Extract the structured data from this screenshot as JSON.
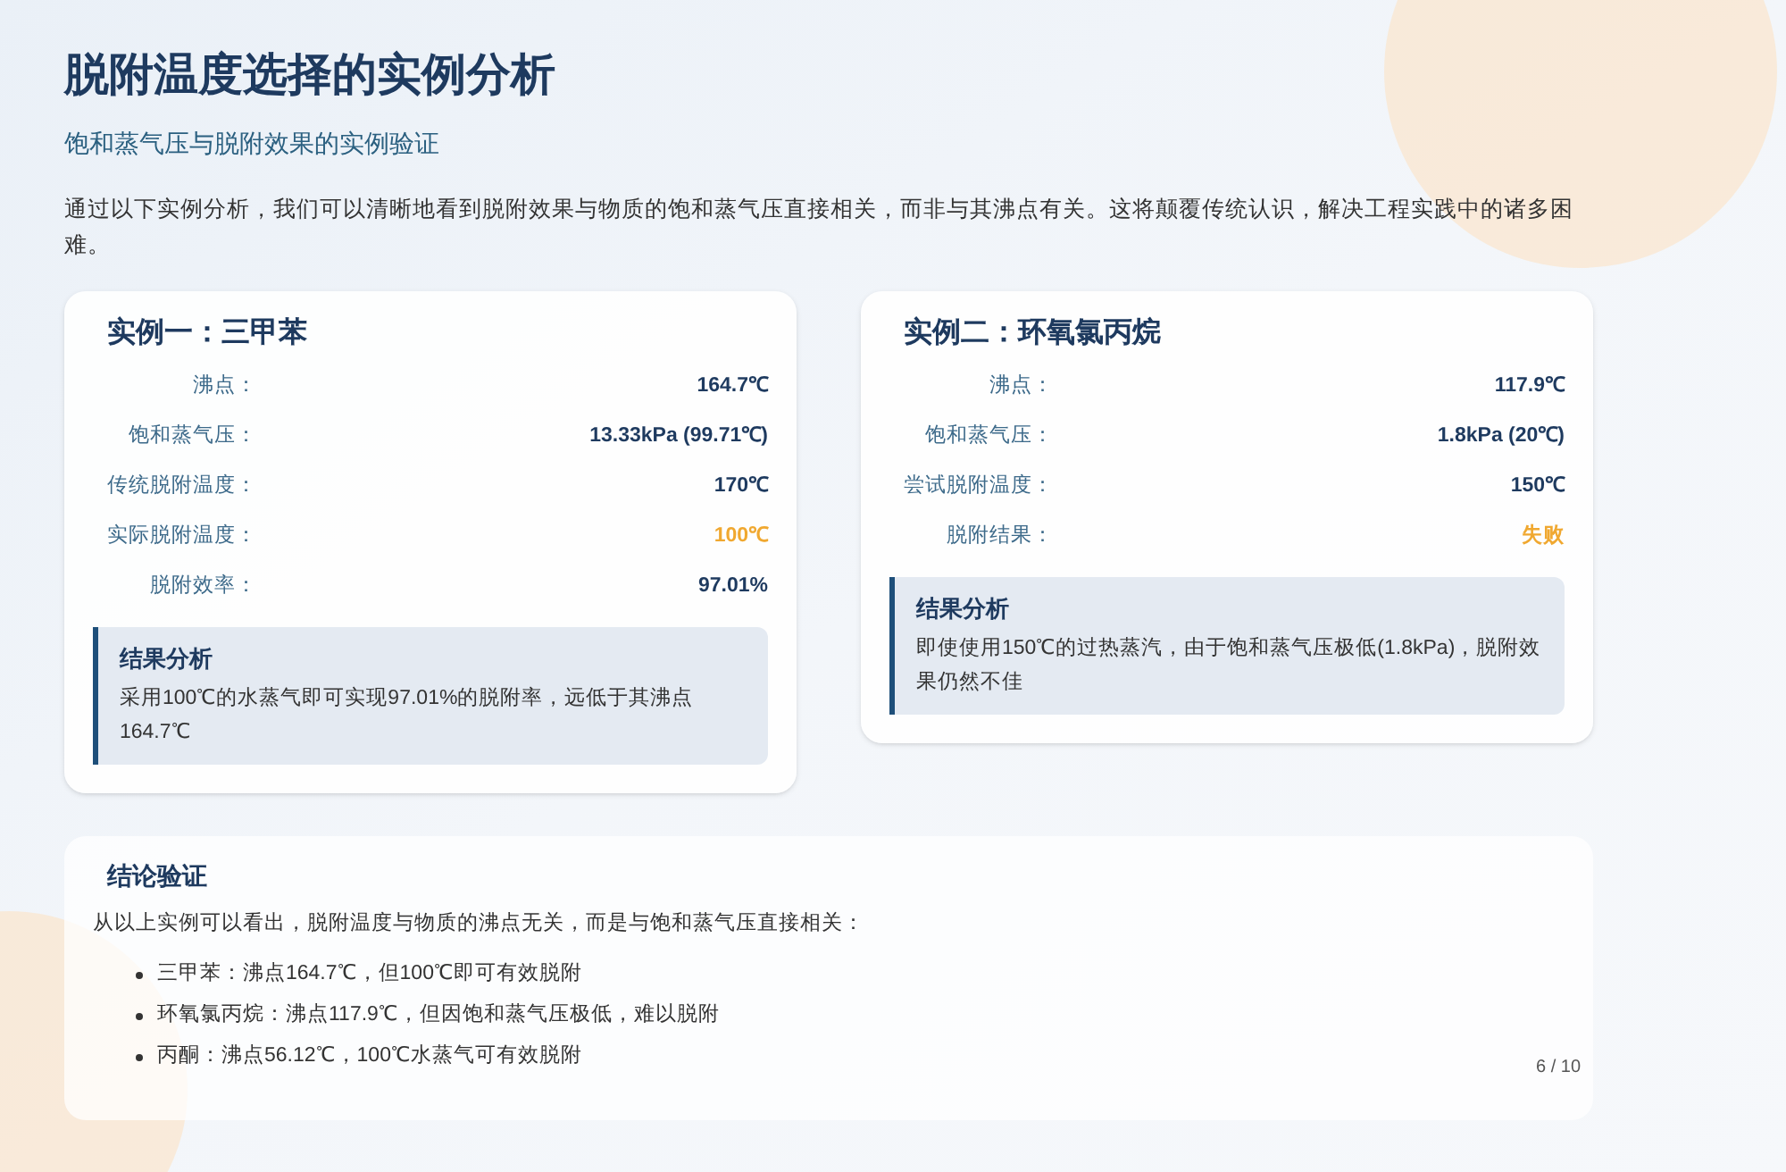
{
  "title": "脱附温度选择的实例分析",
  "subtitle": "饱和蒸气压与脱附效果的实例验证",
  "intro": "通过以下实例分析，我们可以清晰地看到脱附效果与物质的饱和蒸气压直接相关，而非与其沸点有关。这将颠覆传统认识，解决工程实践中的诸多困难。",
  "cases": [
    {
      "title": "实例一：三甲苯",
      "rows": [
        {
          "label": "沸点：",
          "value": "164.7℃",
          "highlight": false
        },
        {
          "label": "饱和蒸气压：",
          "value": "13.33kPa (99.71℃)",
          "highlight": false
        },
        {
          "label": "传统脱附温度：",
          "value": "170℃",
          "highlight": false
        },
        {
          "label": "实际脱附温度：",
          "value": "100℃",
          "highlight": true
        },
        {
          "label": "脱附效率：",
          "value": "97.01%",
          "highlight": false
        }
      ],
      "analysis": {
        "title": "结果分析",
        "text": "采用100℃的水蒸气即可实现97.01%的脱附率，远低于其沸点164.7℃"
      }
    },
    {
      "title": "实例二：环氧氯丙烷",
      "rows": [
        {
          "label": "沸点：",
          "value": "117.9℃",
          "highlight": false
        },
        {
          "label": "饱和蒸气压：",
          "value": "1.8kPa (20℃)",
          "highlight": false
        },
        {
          "label": "尝试脱附温度：",
          "value": "150℃",
          "highlight": false
        },
        {
          "label": "脱附结果：",
          "value": "失败",
          "highlight": true
        }
      ],
      "analysis": {
        "title": "结果分析",
        "text": "即使使用150℃的过热蒸汽，由于饱和蒸气压极低(1.8kPa)，脱附效果仍然不佳"
      }
    }
  ],
  "conclusion": {
    "title": "结论验证",
    "text": "从以上实例可以看出，脱附温度与物质的沸点无关，而是与饱和蒸气压直接相关：",
    "bullets": [
      "三甲苯：沸点164.7℃，但100℃即可有效脱附",
      "环氧氯丙烷：沸点117.9℃，但因饱和蒸气压极低，难以脱附",
      "丙酮：沸点56.12℃，100℃水蒸气可有效脱附"
    ]
  },
  "page_number": "6 / 10"
}
